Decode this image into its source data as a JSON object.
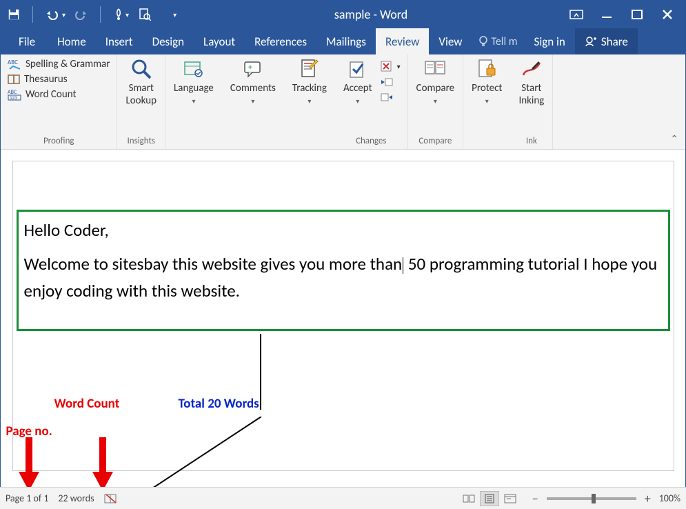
{
  "title": "sample - Word",
  "tabs": {
    "file": "File",
    "home": "Home",
    "insert": "Insert",
    "design": "Design",
    "layout": "Layout",
    "references": "References",
    "mailings": "Mailings",
    "review": "Review",
    "view": "View"
  },
  "tellme": "Tell m",
  "signin": "Sign in",
  "share": "Share",
  "ribbon": {
    "proofing": {
      "spelling": "Spelling & Grammar",
      "thesaurus": "Thesaurus",
      "wordcount": "Word Count",
      "label": "Proofing"
    },
    "insights": {
      "smart_lookup": "Smart\nLookup",
      "label": "Insights"
    },
    "language": {
      "btn": "Language"
    },
    "comments": {
      "btn": "Comments"
    },
    "tracking": {
      "btn": "Tracking"
    },
    "changes": {
      "accept": "Accept",
      "label": "Changes"
    },
    "compare": {
      "btn": "Compare",
      "label": "Compare"
    },
    "protect": {
      "btn": "Protect"
    },
    "ink": {
      "btn": "Start\nInking",
      "label": "Ink"
    }
  },
  "document": {
    "line1": "Hello Coder,",
    "line2a": "Welcome to sitesbay this website gives you more than",
    "line2b": "50 programming tutorial I hope you enjoy coding with this website."
  },
  "annotations": {
    "word_count": "Word Count",
    "total_words": "Total 20 Words",
    "page_no": "Page no."
  },
  "statusbar": {
    "page": "Page 1 of 1",
    "words": "22 words",
    "zoom": "100%"
  }
}
